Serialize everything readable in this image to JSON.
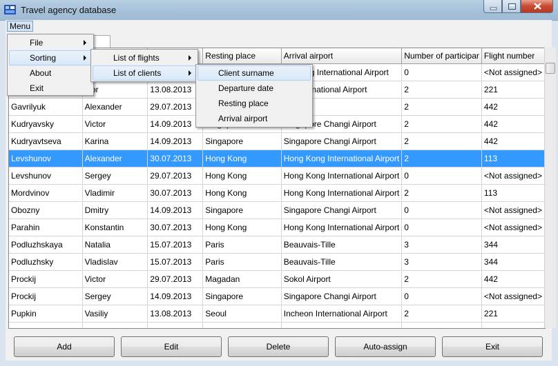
{
  "window": {
    "title": "Travel agency database"
  },
  "menubar": {
    "menu_label": "Menu"
  },
  "tab": {
    "label": "nts"
  },
  "menu": {
    "main": [
      "File",
      "Sorting",
      "About",
      "Exit"
    ],
    "sorting": [
      "List of flights",
      "List of clients"
    ],
    "clients": [
      "Client surname",
      "Departure date",
      "Resting place",
      "Arrival airport"
    ]
  },
  "table": {
    "headers": [
      "",
      "",
      "e",
      "Resting place",
      "Arrival airport",
      "Number of participar",
      "Flight number"
    ],
    "rows": [
      [
        "",
        "",
        "",
        "",
        "ng Kong International Airport",
        "0",
        "<Not assigned>"
      ],
      [
        "",
        "ctor",
        "13.08.2013",
        "",
        "on International Airport",
        "2",
        "221"
      ],
      [
        "Gavrilyuk",
        "Alexander",
        "29.07.2013",
        "",
        "Airport",
        "2",
        "442"
      ],
      [
        "Kudryavsky",
        "Victor",
        "14.09.2013",
        "Singapore",
        "Singapore Changi Airport",
        "2",
        "442"
      ],
      [
        "Kudryavtseva",
        "Karina",
        "14.09.2013",
        "Singapore",
        "Singapore Changi Airport",
        "2",
        "442"
      ],
      [
        "Levshunov",
        "Alexander",
        "30.07.2013",
        "Hong Kong",
        "Hong Kong International Airport",
        "2",
        "113"
      ],
      [
        "Levshunov",
        "Sergey",
        "29.07.2013",
        "Hong Kong",
        "Hong Kong International Airport",
        "0",
        "<Not assigned>"
      ],
      [
        "Mordvinov",
        "Vladimir",
        "30.07.2013",
        "Hong Kong",
        "Hong Kong International Airport",
        "2",
        "113"
      ],
      [
        "Obozny",
        "Dmitry",
        "14.09.2013",
        "Singapore",
        "Singapore Changi Airport",
        "0",
        "<Not assigned>"
      ],
      [
        "Parahin",
        "Konstantin",
        "30.07.2013",
        "Hong Kong",
        "Hong Kong International Airport",
        "0",
        "<Not assigned>"
      ],
      [
        "Podluzhskaya",
        "Natalia",
        "15.07.2013",
        "Paris",
        "Beauvais-Tille",
        "3",
        "344"
      ],
      [
        "Podluzhsky",
        "Vladislav",
        "15.07.2013",
        "Paris",
        "Beauvais-Tille",
        "3",
        "344"
      ],
      [
        "Prockij",
        "Victor",
        "29.07.2013",
        "Magadan",
        "Sokol Airport",
        "2",
        "442"
      ],
      [
        "Prockij",
        "Sergey",
        "14.09.2013",
        "Singapore",
        "Singapore Changi Airport",
        "0",
        "<Not assigned>"
      ],
      [
        "Pupkin",
        "Vasiliy",
        "13.08.2013",
        "Seoul",
        "Incheon International Airport",
        "2",
        "221"
      ],
      [
        "",
        "",
        "",
        "",
        "",
        "",
        ""
      ]
    ]
  },
  "buttons": {
    "add": "Add",
    "edit": "Edit",
    "delete": "Delete",
    "auto_assign": "Auto-assign",
    "exit": "Exit"
  },
  "colors": {
    "selection": "#3399ff",
    "titlebar": "#a5c0d9",
    "close": "#c74a32"
  }
}
